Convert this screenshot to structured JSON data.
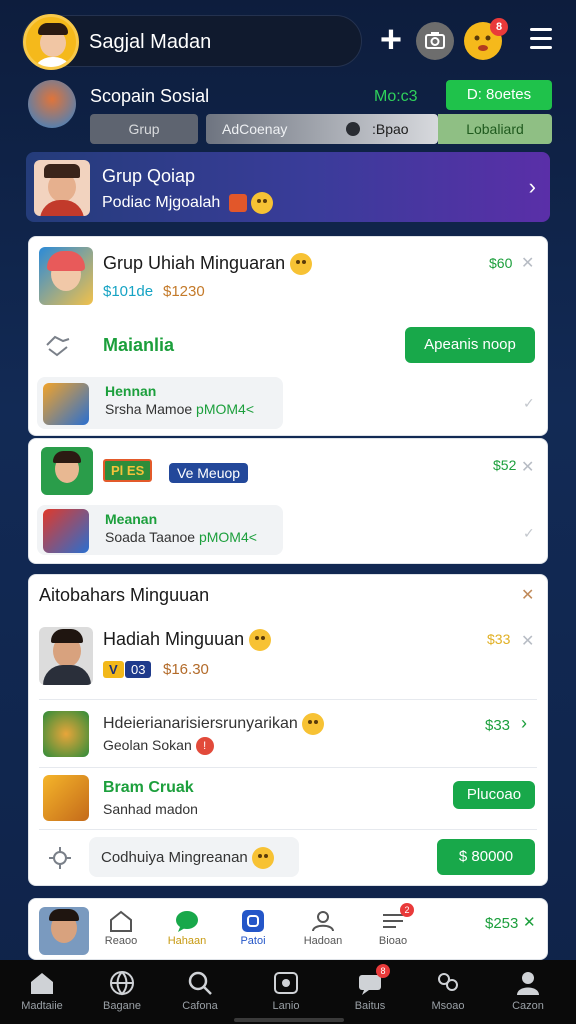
{
  "header": {
    "user_name": "Sagjal Madan",
    "notif_count": "8"
  },
  "social": {
    "title": "Scopain Sosial",
    "tag": "Mo:c3",
    "action_label": "D: 8oetes",
    "segments": {
      "grup": "Grup",
      "toggle_left": "AdCoenay",
      "toggle_right": ":Bpao",
      "right": "Lobaliard"
    }
  },
  "banner": {
    "title": "Grup Qoiap",
    "subtitle": "Podiac Mjgoalah"
  },
  "card1": {
    "title": "Grup Uhiah Minguaran",
    "amount": "$60",
    "price_primary": "$101de",
    "price_secondary": "$1230",
    "section_label": "Maianlia",
    "action_label": "Apeanis noop",
    "sub_item": {
      "title": "Hennan",
      "subtitle": "Srsha Mamoe",
      "code": "pMOM4<"
    }
  },
  "card2": {
    "badge_game": "Pl ES",
    "badge_blue": "Ve Meuop",
    "amount": "$52",
    "sub_item": {
      "title": "Meanan",
      "subtitle": "Soada Taanoe",
      "code": "pMOM4<"
    }
  },
  "card3": {
    "header": "Aitobahars Minguuan",
    "featured": {
      "title": "Hadiah Minguuan",
      "amount": "$33",
      "badge_yellow": "V",
      "badge_blue": "03",
      "price": "$16.30"
    },
    "row1": {
      "title": "Hdeierianarisiersrunyarikan",
      "subtitle": "Geolan Sokan",
      "amount": "$33"
    },
    "row2": {
      "title": "Bram Cruak",
      "subtitle": "Sanhad madon",
      "action_label": "Plucoao"
    },
    "row3": {
      "title": "Codhuiya Mingreanan",
      "action_label": "$ 80000"
    }
  },
  "inner_nav": {
    "items": [
      {
        "label": "Reaoo",
        "icon": "home-outline-icon"
      },
      {
        "label": "Hahaan",
        "icon": "chat-bubble-icon"
      },
      {
        "label": "Patoi",
        "icon": "square-app-icon"
      },
      {
        "label": "Hadoan",
        "icon": "person-outline-icon"
      },
      {
        "label": "Bioao",
        "icon": "inbox-icon"
      }
    ],
    "amount": "$253",
    "badge": "2"
  },
  "bottom_nav": {
    "items": [
      {
        "label": "Madtaiie",
        "icon": "home-icon"
      },
      {
        "label": "Bagane",
        "icon": "globe-icon"
      },
      {
        "label": "Cafona",
        "icon": "search-icon"
      },
      {
        "label": "Lanio",
        "icon": "camera-icon"
      },
      {
        "label": "Baitus",
        "icon": "chat-icon"
      },
      {
        "label": "Msoao",
        "icon": "group-icon"
      },
      {
        "label": "Cazon",
        "icon": "profile-icon"
      }
    ],
    "badge": "8"
  },
  "colors": {
    "brand_green": "#18a84a",
    "background_navy": "#0f2349",
    "banner_purple": "#5a2fa8",
    "notif_red": "#e93a3a"
  }
}
